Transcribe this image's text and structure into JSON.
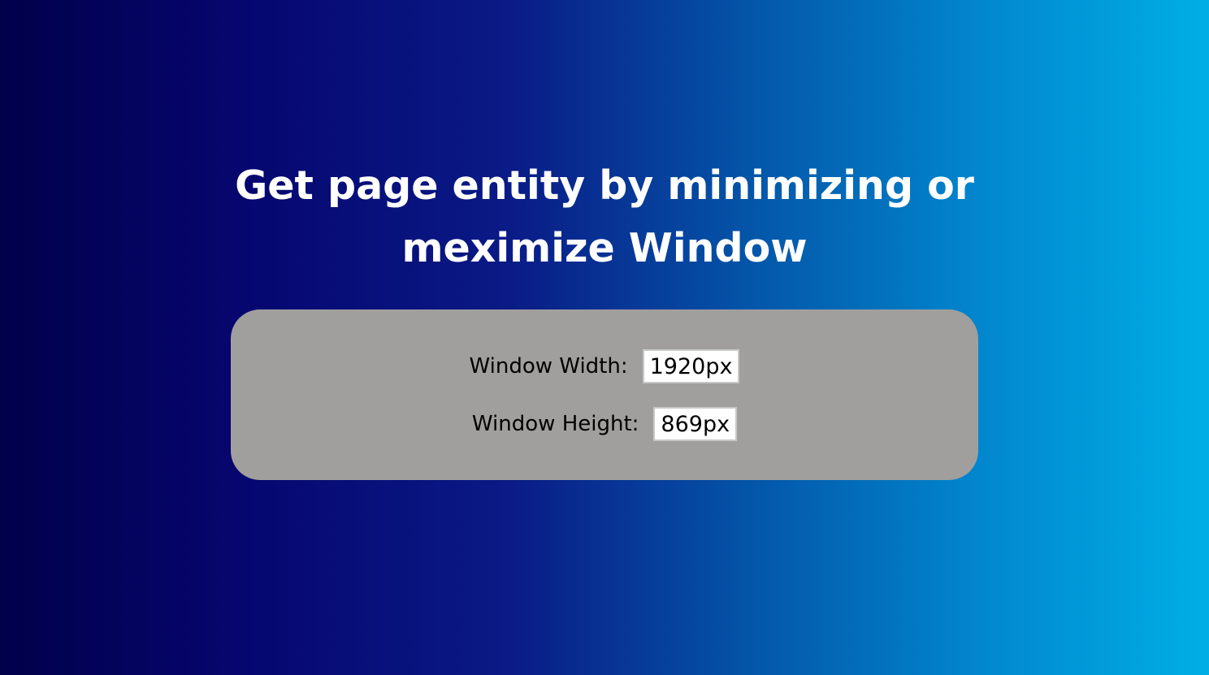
{
  "heading": {
    "line1": "Get page entity by minimizing or",
    "line2": "meximize Window"
  },
  "dimensions": {
    "width_label": "Window Width:",
    "width_value": "1920px",
    "height_label": "Window Height:",
    "height_value": "869px"
  },
  "colors": {
    "gradient_start": "#01004a",
    "gradient_end": "#00afe6",
    "panel": "#a09f9d",
    "heading_text": "#ffffff"
  }
}
